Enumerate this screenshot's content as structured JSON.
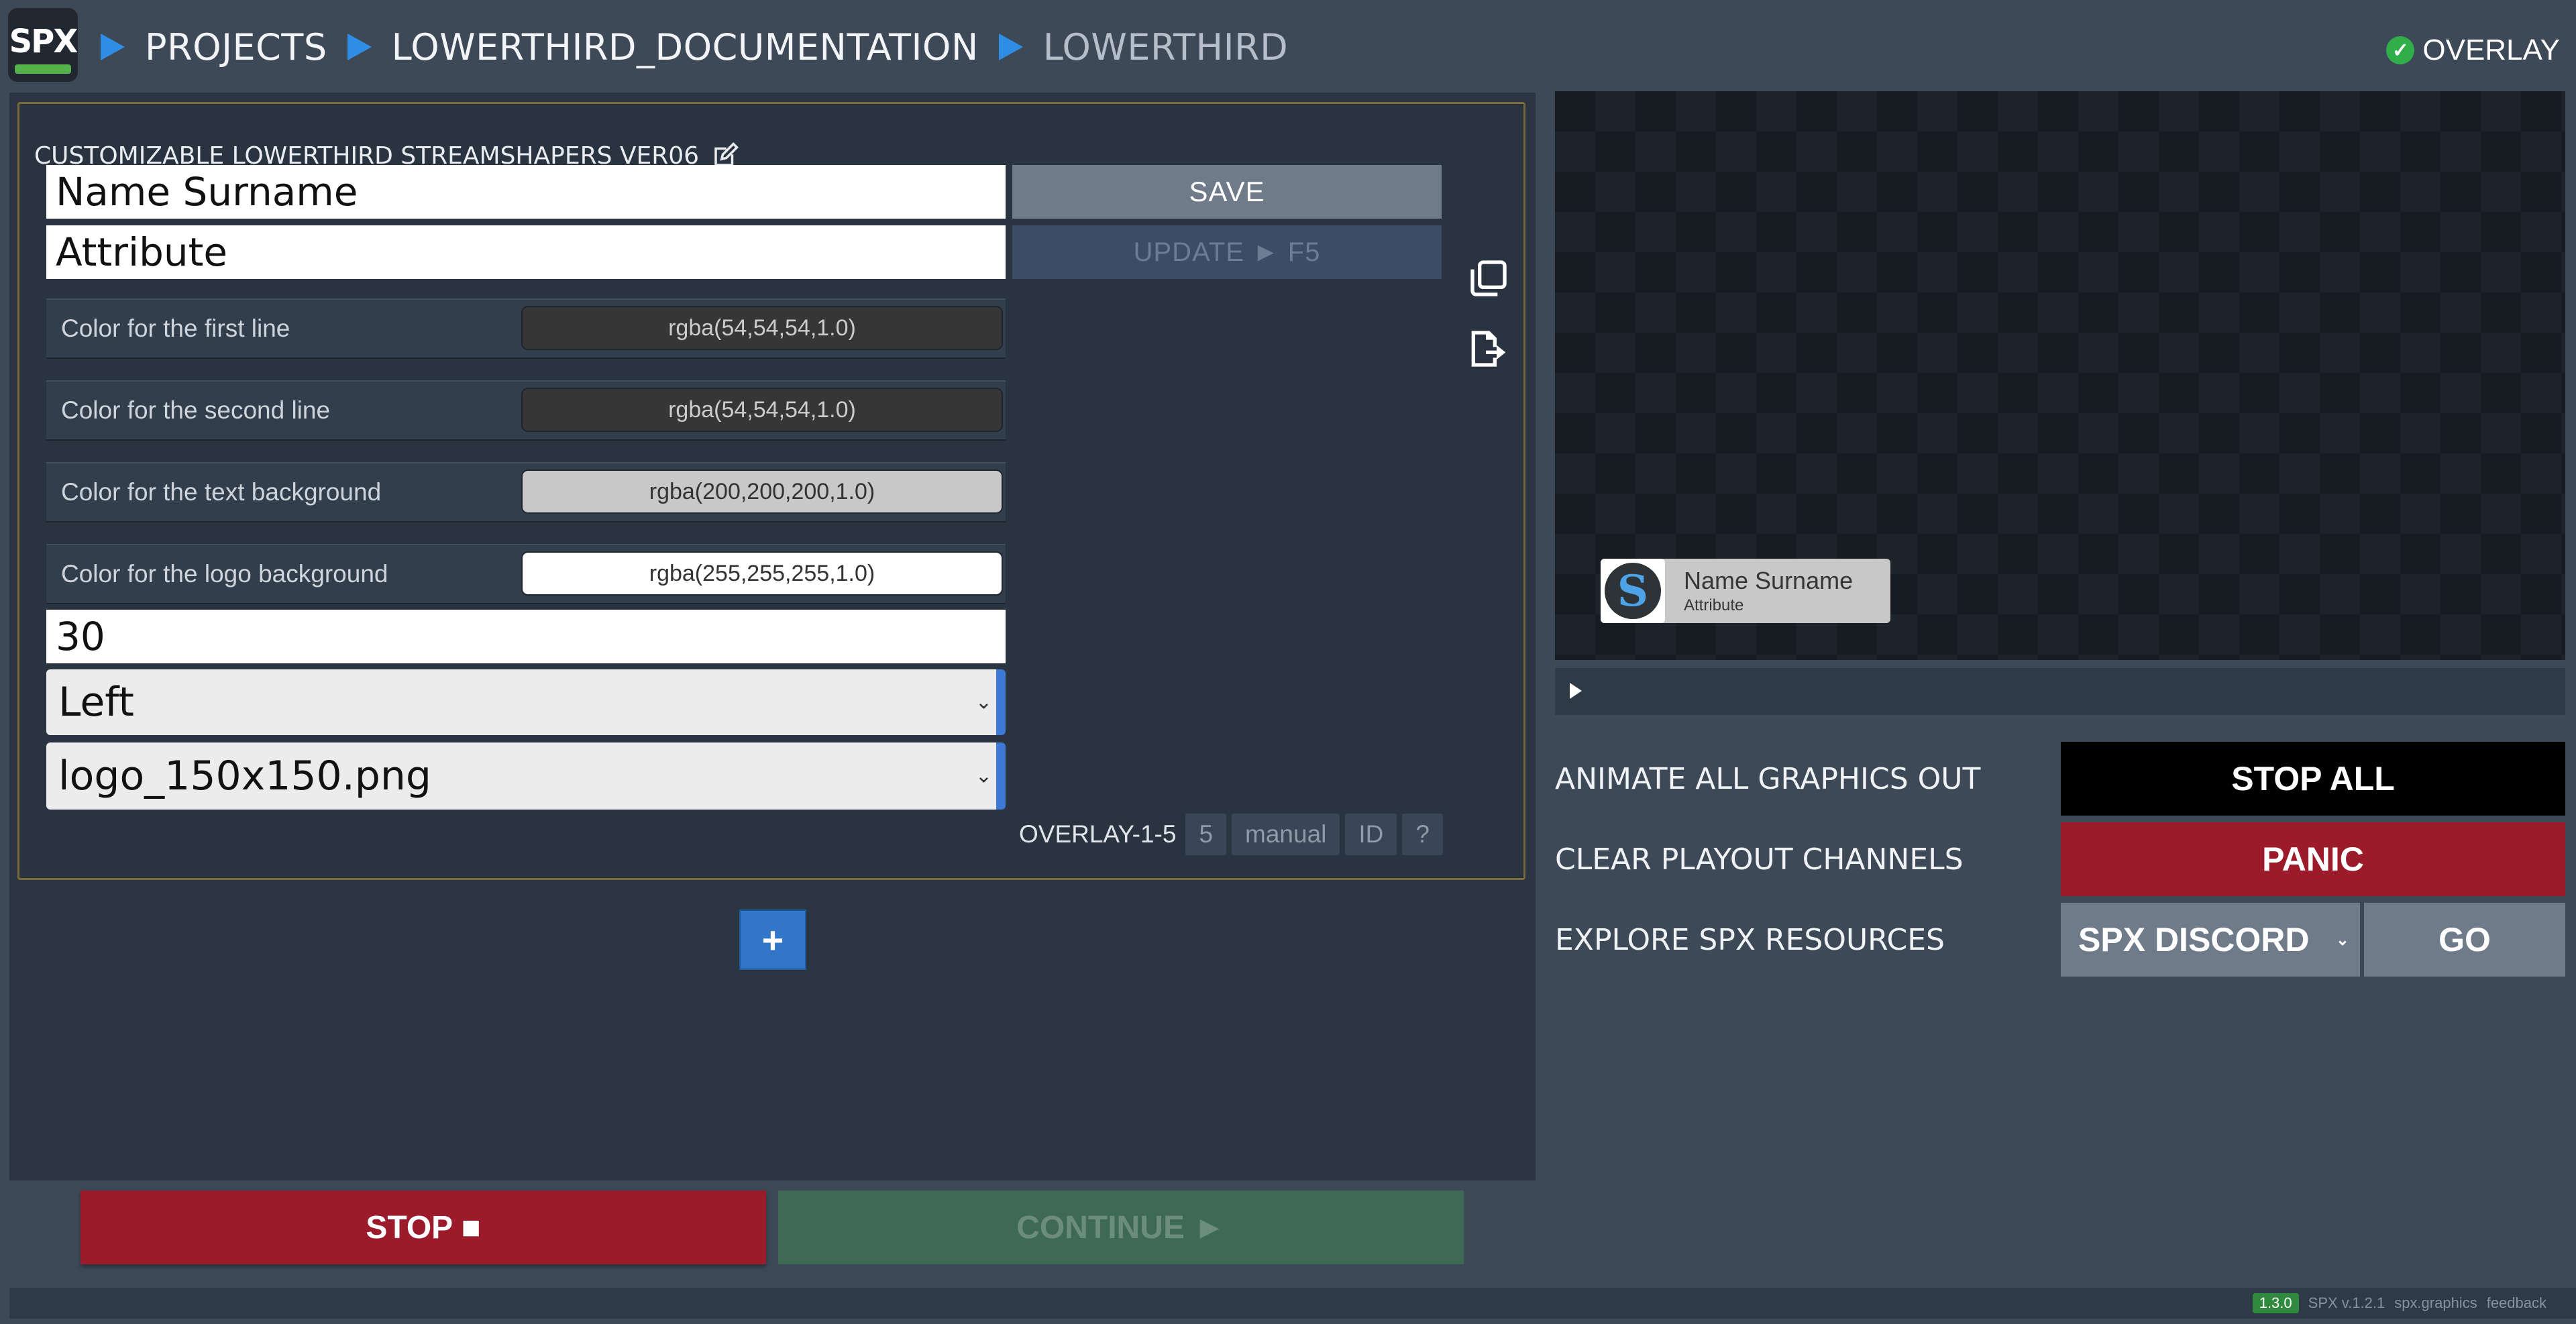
{
  "app": {
    "logo_text": "SPX"
  },
  "breadcrumb": [
    "PROJECTS",
    "LOWERTHIRD_DOCUMENTATION",
    "LOWERTHIRD"
  ],
  "status": {
    "label": "OVERLAY",
    "color": "#2fae4a"
  },
  "template": {
    "title": "CUSTOMIZABLE LOWERTHIRD STREAMSHAPERS VER06",
    "field_line1": "Name Surname",
    "field_line2": "Attribute",
    "save_label": "SAVE",
    "update_label": "UPDATE ► F5",
    "color_fields": [
      {
        "label": "Color for the first line",
        "value": "rgba(54,54,54,1.0)",
        "bg": "#363636",
        "fg": "#cccccc"
      },
      {
        "label": "Color for the second line",
        "value": "rgba(54,54,54,1.0)",
        "bg": "#363636",
        "fg": "#cccccc"
      },
      {
        "label": "Color for the text background",
        "value": "rgba(200,200,200,1.0)",
        "bg": "#c8c8c8",
        "fg": "#333333"
      },
      {
        "label": "Color for the logo background",
        "value": "rgba(255,255,255,1.0)",
        "bg": "#ffffff",
        "fg": "#333333"
      }
    ],
    "number_field": "30",
    "position_select": "Left",
    "logo_select": "logo_150x150.png",
    "overlay_label": "OVERLAY-1-5",
    "layer_chip": "5",
    "mode_chip": "manual",
    "id_chip": "ID",
    "help_chip": "?"
  },
  "add_button_label": "+",
  "controls": {
    "stop_label": "STOP ■",
    "continue_label": "CONTINUE ►"
  },
  "preview": {
    "name": "Name Surname",
    "attribute": "Attribute",
    "logo_glyph": "S"
  },
  "right": {
    "animate_label": "ANIMATE ALL GRAPHICS OUT",
    "stopall_label": "STOP ALL",
    "clear_label": "CLEAR PLAYOUT CHANNELS",
    "panic_label": "PANIC",
    "explore_label": "EXPLORE SPX RESOURCES",
    "resource_select": "SPX DISCORD",
    "go_label": "GO"
  },
  "footer": {
    "badge": "1.3.0",
    "version": "SPX v.1.2.1",
    "site": "spx.graphics",
    "feedback": "feedback"
  }
}
